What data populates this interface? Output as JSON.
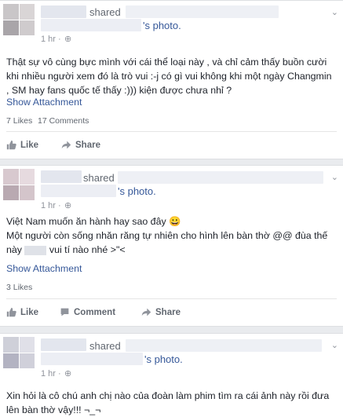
{
  "colors": {
    "link": "#365899",
    "muted": "#616770",
    "meta": "#90949c",
    "bg": "#e9ebee"
  },
  "icons": {
    "globe": "globe-icon",
    "chevron": "chevron-down-icon",
    "like": "thumbs-up-icon",
    "share": "share-arrow-icon",
    "comment": "comment-icon"
  },
  "posts": [
    {
      "shared": "shared",
      "photo": "'s photo.",
      "time": "1 hr ·",
      "text": [
        "Thật sự vô cùng bực mình với cái thể loại này , và chỉ cảm thấy buồn cười",
        "khi nhiều người xem đó là trò vui :-j có gì vui không khi một ngày Changmin",
        ", SM hay fans quốc tế thấy :))) kiện được chưa nhỉ ?"
      ],
      "attachment": "Show Attachment",
      "likes": "7 Likes",
      "comments": "17 Comments",
      "like_label": "Like",
      "share_label": "Share"
    },
    {
      "shared": "shared",
      "photo": "'s photo.",
      "time": "1 hr ·",
      "text": [
        "Việt Nam muốn ăn hành hay sao đây 😀",
        "Một người còn sống nhăn răng tự nhiên cho hình lên bàn thờ @@ đùa thế",
        "này",
        "vui tí nào nhé >\"<"
      ],
      "attachment": "Show Attachment",
      "likes": "3 Likes",
      "like_label": "Like",
      "comment_label": "Comment",
      "share_label": "Share"
    },
    {
      "shared": "shared",
      "photo": "'s photo.",
      "time": "1 hr ·",
      "text": [
        "Xin hỏi là cô chú anh chị nào của đoàn làm phim tìm ra cái ảnh này rồi đưa",
        "lên bàn thờ vậy!!! ¬_¬"
      ]
    }
  ]
}
